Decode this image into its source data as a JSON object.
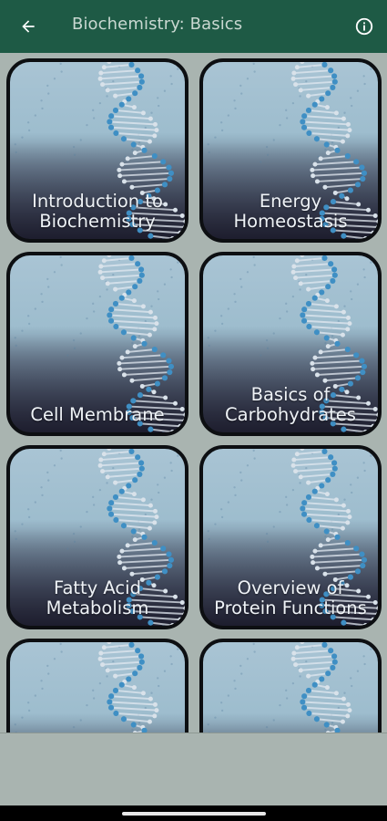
{
  "appbar": {
    "title": "Biochemistry: Basics",
    "back_icon": "arrow-left-icon",
    "info_icon": "info-circle-icon",
    "color": "#1e5a45"
  },
  "cards": [
    {
      "label": "Introduction to\nBiochemistry"
    },
    {
      "label": "Energy\nHomeostasis"
    },
    {
      "label": "Cell Membrane"
    },
    {
      "label": "Basics of\nCarbohydrates"
    },
    {
      "label": "Fatty Acid\nMetabolism"
    },
    {
      "label": "Overview of\nProtein Functions"
    },
    {
      "label": ""
    },
    {
      "label": ""
    }
  ]
}
